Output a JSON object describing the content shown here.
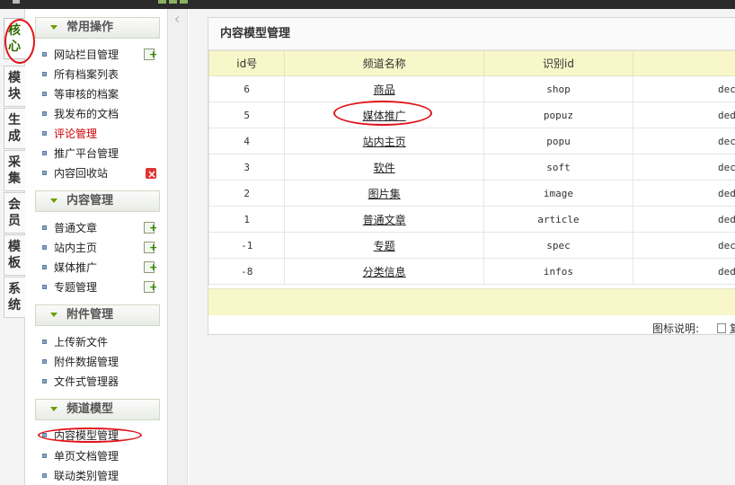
{
  "vertical_tabs": [
    {
      "label": "核心",
      "active": true
    },
    {
      "label": "模块",
      "active": false
    },
    {
      "label": "生成",
      "active": false
    },
    {
      "label": "采集",
      "active": false
    },
    {
      "label": "会员",
      "active": false
    },
    {
      "label": "模板",
      "active": false
    },
    {
      "label": "系统",
      "active": false
    }
  ],
  "sidebar": {
    "groups": [
      {
        "title": "常用操作",
        "items": [
          {
            "label": "网站栏目管理",
            "icon": "add-icon"
          },
          {
            "label": "所有档案列表",
            "icon": ""
          },
          {
            "label": "等审核的档案",
            "icon": ""
          },
          {
            "label": "我发布的文档",
            "icon": ""
          },
          {
            "label": "评论管理",
            "icon": "",
            "highlight": true
          },
          {
            "label": "推广平台管理",
            "icon": ""
          },
          {
            "label": "内容回收站",
            "icon": "delete-icon"
          }
        ]
      },
      {
        "title": "内容管理",
        "items": [
          {
            "label": "普通文章",
            "icon": "add-icon"
          },
          {
            "label": "站内主页",
            "icon": "add-icon"
          },
          {
            "label": "媒体推广",
            "icon": "add-icon"
          },
          {
            "label": "专题管理",
            "icon": "add-icon"
          }
        ]
      },
      {
        "title": "附件管理",
        "items": [
          {
            "label": "上传新文件",
            "icon": ""
          },
          {
            "label": "附件数据管理",
            "icon": ""
          },
          {
            "label": "文件式管理器",
            "icon": ""
          }
        ]
      },
      {
        "title": "频道模型",
        "items": [
          {
            "label": "内容模型管理",
            "icon": ""
          },
          {
            "label": "单页文档管理",
            "icon": ""
          },
          {
            "label": "联动类别管理",
            "icon": ""
          }
        ]
      }
    ]
  },
  "panel": {
    "title": "内容模型管理",
    "columns": [
      "id号",
      "频道名称",
      "识别id",
      ""
    ],
    "rows": [
      {
        "id": "6",
        "name": "商品",
        "nid": "shop",
        "table": "dec"
      },
      {
        "id": "5",
        "name": "媒体推广",
        "nid": "popuz",
        "table": "ded"
      },
      {
        "id": "4",
        "name": "站内主页",
        "nid": "popu",
        "table": "dec"
      },
      {
        "id": "3",
        "name": "软件",
        "nid": "soft",
        "table": "dec"
      },
      {
        "id": "2",
        "name": "图片集",
        "nid": "image",
        "table": "dede"
      },
      {
        "id": "1",
        "name": "普通文章",
        "nid": "article",
        "table": "dede"
      },
      {
        "id": "-1",
        "name": "专题",
        "nid": "spec",
        "table": "dec"
      },
      {
        "id": "-8",
        "name": "分类信息",
        "nid": "infos",
        "table": "ded"
      }
    ],
    "legend_label": "图标说明:",
    "legend_tail": "复"
  },
  "colors": {
    "annotation_red": "#e0151b",
    "header_yellow": "#f7f7c9",
    "highlight_red": "#cc0000"
  }
}
